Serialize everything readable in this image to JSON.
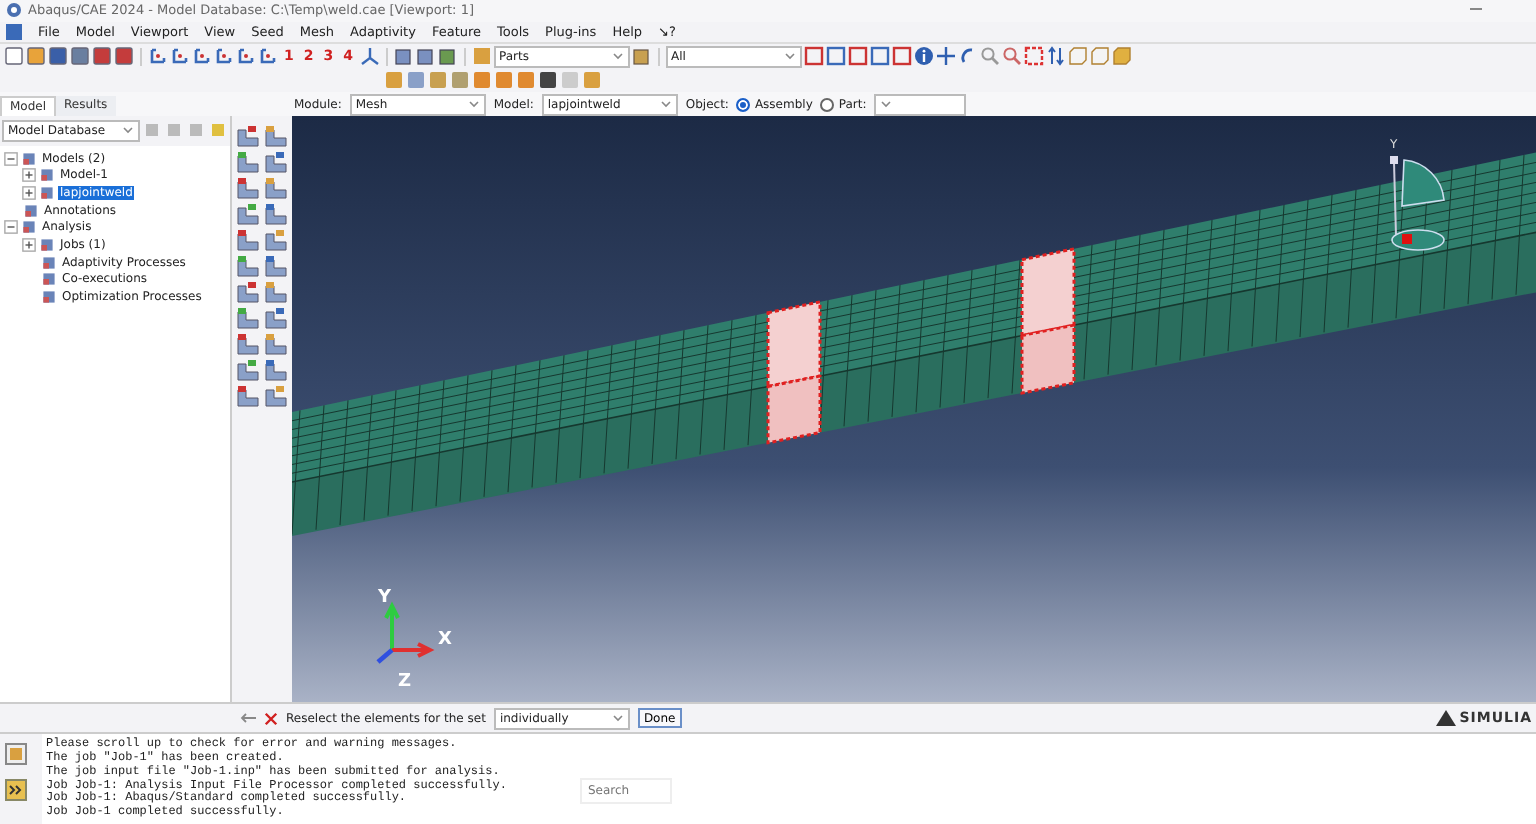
{
  "window": {
    "title": "Abaqus/CAE 2024 - Model Database: C:\\Temp\\weld.cae [Viewport: 1]"
  },
  "menu": [
    "File",
    "Model",
    "Viewport",
    "View",
    "Seed",
    "Mesh",
    "Adaptivity",
    "Feature",
    "Tools",
    "Plug-ins",
    "Help",
    "↘?"
  ],
  "toolbar": {
    "numbers": [
      "1",
      "2",
      "3",
      "4"
    ],
    "parts_combo": "Parts",
    "filter_combo": "All"
  },
  "tabs": [
    {
      "label": "Model",
      "selected": true
    },
    {
      "label": "Results",
      "selected": false
    }
  ],
  "context": {
    "module_label": "Module:",
    "module": "Mesh",
    "model_label": "Model:",
    "model": "lapjointweld",
    "object_label": "Object:",
    "objects": [
      {
        "label": "Assembly",
        "selected": true
      },
      {
        "label": "Part:",
        "selected": false
      }
    ]
  },
  "tree_source": "Model Database",
  "tree": [
    {
      "label": "Models (2)",
      "expanded": true,
      "selected": false,
      "children": [
        {
          "label": "Model-1",
          "expanded": false,
          "selected": false
        },
        {
          "label": "lapjointweld",
          "expanded": false,
          "selected": true
        }
      ]
    },
    {
      "label": "Annotations",
      "selected": false
    },
    {
      "label": "Analysis",
      "expanded": true,
      "selected": false,
      "children": [
        {
          "label": "Jobs (1)",
          "expanded": false,
          "selected": false
        },
        {
          "label": "Adaptivity Processes",
          "selected": false
        },
        {
          "label": "Co-executions",
          "selected": false
        },
        {
          "label": "Optimization Processes",
          "selected": false
        }
      ]
    }
  ],
  "viewport": {
    "triad": [
      "Y",
      "X",
      "Z"
    ],
    "mini_triad": "Y",
    "logo": "SIMULIA"
  },
  "prompt": {
    "text": "Reselect the elements for the set",
    "method": "individually",
    "button": "Done"
  },
  "messages": [
    "Please scroll up to check for error and warning messages.",
    "The job \"Job-1\" has been created.",
    "The job input file \"Job-1.inp\" has been submitted for analysis.",
    "Job Job-1: Analysis Input File Processor completed successfully.",
    "Job Job-1: Abaqus/Standard completed successfully.",
    "Job Job-1 completed successfully."
  ],
  "search": {
    "placeholder": "Search"
  }
}
